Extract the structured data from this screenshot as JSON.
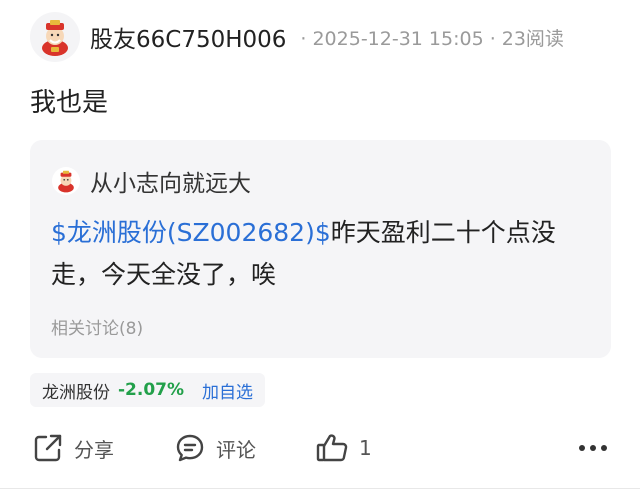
{
  "post": {
    "username": "股友66C750H006",
    "timestamp": "2025-12-31 15:05",
    "read_count": "23阅读",
    "text": "我也是",
    "avatar_icon": "god-of-wealth-avatar"
  },
  "quote": {
    "author": "从小志向就远大",
    "stock_link": "$龙洲股份(SZ002682)$",
    "body_text": "昨天盈利二十个点没走，今天全没了，唉",
    "related": "相关讨论(8)"
  },
  "stock_tag": {
    "name": "龙洲股份",
    "change": "-2.07%",
    "change_color": "#22a04a",
    "add_watch": "加自选"
  },
  "actions": {
    "share": "分享",
    "comment": "评论",
    "like_count": "1"
  },
  "colors": {
    "link": "#2a6fd6",
    "card_bg": "#f5f5f7"
  }
}
